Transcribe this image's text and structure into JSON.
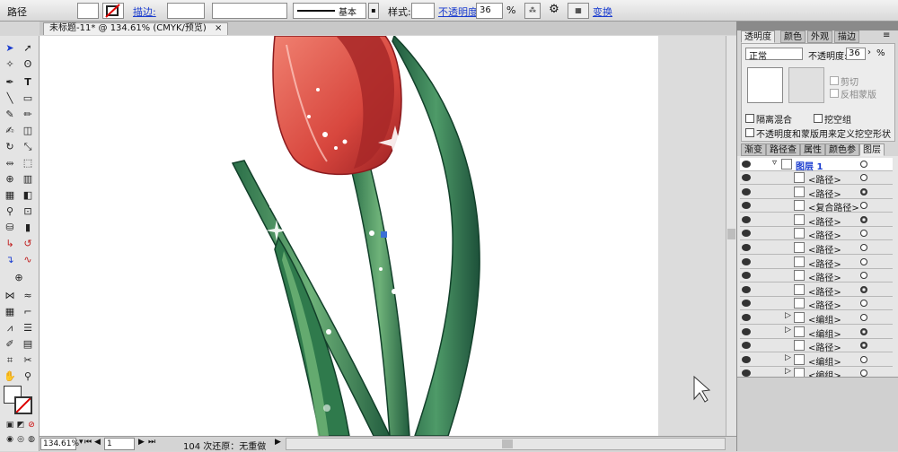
{
  "control_bar": {
    "object_label": "路径",
    "stroke_link": "描边:",
    "stroke_style_label": "基本",
    "style_label": "样式:",
    "opacity_link": "不透明度:",
    "opacity_value": "36",
    "opacity_unit": "%",
    "transform_link": "变换"
  },
  "document_tab": {
    "title": "未标题-11* @ 134.61% (CMYK/预览)",
    "close": "×"
  },
  "status_bar": {
    "zoom": "134.61%",
    "artboard": "1",
    "info": "104 次还原：无重做"
  },
  "transparency_panel": {
    "tabs": [
      "透明度",
      "颜色",
      "外观",
      "描边"
    ],
    "blend_mode": "正常",
    "opacity_label": "不透明度:",
    "opacity_value": "36",
    "opacity_unit": "%",
    "clip_label": "剪切",
    "invert_mask_label": "反相蒙版",
    "isolate_blending_label": "隔离混合",
    "knockout_group_label": "挖空组",
    "opacity_mask_label": "不透明度和蒙版用来定义挖空形状"
  },
  "layers_panel": {
    "tabs": [
      "渐变",
      "路径查",
      "属性",
      "颜色参",
      "图层"
    ],
    "layer_name": "图层 1",
    "rows": [
      "<路径>",
      "<路径>",
      "<复合路径>",
      "<路径>",
      "<路径>",
      "<路径>",
      "<路径>",
      "<路径>",
      "<路径>",
      "<路径>",
      "<编组>",
      "<编组>",
      "<路径>",
      "<编组>",
      "<编组>"
    ]
  },
  "colors": {
    "selection_blue": "#3b6fd6",
    "leaf_dark": "#1f5a3e",
    "leaf_mid": "#3c8a5a",
    "petal": "#e05a4a"
  }
}
